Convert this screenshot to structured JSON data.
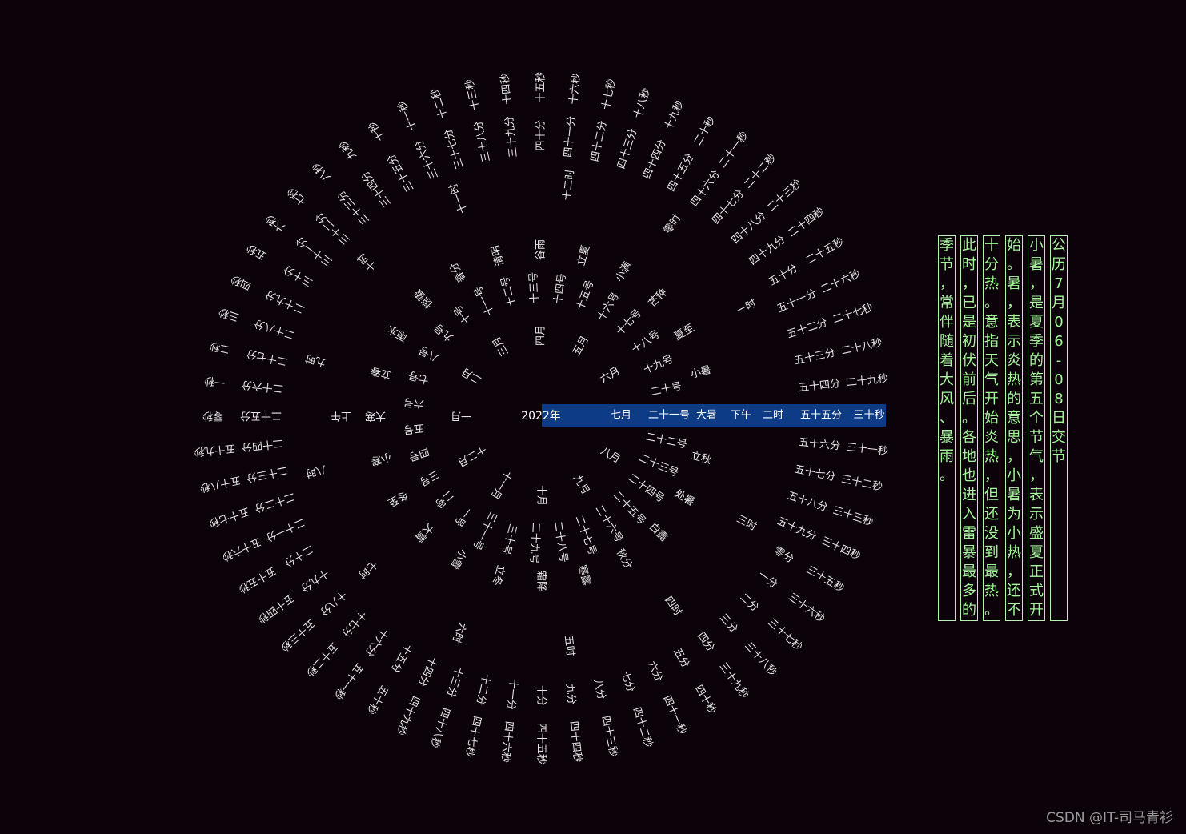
{
  "colors": {
    "background": "#0b0309",
    "highlight": "#0e3b86",
    "text": "#e6e6e6",
    "poem_text": "#a5f59a",
    "poem_border": "#b7f2b0"
  },
  "center": {
    "year": "2022年"
  },
  "rings": [
    {
      "name": "month",
      "current": 6,
      "labels": [
        "一月",
        "二月",
        "三月",
        "四月",
        "五月",
        "六月",
        "七月",
        "八月",
        "九月",
        "十月",
        "十一月",
        "十二月"
      ]
    },
    {
      "name": "solar-term",
      "current": 11,
      "labels": [
        "立春",
        "雨水",
        "惊蛰",
        "春分",
        "清明",
        "谷雨",
        "立夏",
        "小满",
        "芒种",
        "夏至",
        "小暑",
        "大暑",
        "立秋",
        "处暑",
        "白露",
        "秋分",
        "寒露",
        "霜降",
        "立冬",
        "小雪",
        "大雪",
        "冬至",
        "小寒",
        "大寒"
      ]
    },
    {
      "name": "day",
      "current": 20,
      "labels": [
        "一号",
        "二号",
        "三号",
        "四号",
        "五号",
        "六号",
        "七号",
        "八号",
        "九号",
        "十号",
        "十一号",
        "十二号",
        "十三号",
        "十四号",
        "十五号",
        "十六号",
        "十七号",
        "十八号",
        "十九号",
        "二十号",
        "二十一号",
        "二十二号",
        "二十三号",
        "二十四号",
        "二十五号",
        "二十六号",
        "二十七号",
        "二十八号",
        "二十九号",
        "三十号",
        "三十一号"
      ]
    },
    {
      "name": "ampm",
      "current": 1,
      "labels": [
        "上午",
        "下午"
      ]
    },
    {
      "name": "hour",
      "current": 2,
      "labels": [
        "零时",
        "一时",
        "二时",
        "三时",
        "四时",
        "五时",
        "六时",
        "七时",
        "八时",
        "九时",
        "十时",
        "十一时",
        "十二时"
      ]
    },
    {
      "name": "minute",
      "current": 55,
      "labels": [
        "零分",
        "一分",
        "二分",
        "三分",
        "四分",
        "五分",
        "六分",
        "七分",
        "八分",
        "九分",
        "十分",
        "十一分",
        "十二分",
        "十三分",
        "十四分",
        "十五分",
        "十六分",
        "十七分",
        "十八分",
        "十九分",
        "二十分",
        "二十一分",
        "二十二分",
        "二十三分",
        "二十四分",
        "二十五分",
        "二十六分",
        "二十七分",
        "二十八分",
        "二十九分",
        "三十分",
        "三十一分",
        "三十二分",
        "三十三分",
        "三十四分",
        "三十五分",
        "三十六分",
        "三十七分",
        "三十八分",
        "三十九分",
        "四十分",
        "四十一分",
        "四十二分",
        "四十三分",
        "四十四分",
        "四十五分",
        "四十六分",
        "四十七分",
        "四十八分",
        "四十九分",
        "五十分",
        "五十一分",
        "五十二分",
        "五十三分",
        "五十四分",
        "五十五分",
        "五十六分",
        "五十七分",
        "五十八分",
        "五十九分"
      ]
    },
    {
      "name": "second",
      "current": 30,
      "labels": [
        "零秒",
        "一秒",
        "二秒",
        "三秒",
        "四秒",
        "五秒",
        "六秒",
        "七秒",
        "八秒",
        "九秒",
        "十秒",
        "十一秒",
        "十二秒",
        "十三秒",
        "十四秒",
        "十五秒",
        "十六秒",
        "十七秒",
        "十八秒",
        "十九秒",
        "二十秒",
        "二十一秒",
        "二十二秒",
        "二十三秒",
        "二十四秒",
        "二十五秒",
        "二十六秒",
        "二十七秒",
        "二十八秒",
        "二十九秒",
        "三十秒",
        "三十一秒",
        "三十二秒",
        "三十三秒",
        "三十四秒",
        "三十五秒",
        "三十六秒",
        "三十七秒",
        "三十八秒",
        "三十九秒",
        "四十秒",
        "四十一秒",
        "四十二秒",
        "四十三秒",
        "四十四秒",
        "四十五秒",
        "四十六秒",
        "四十七秒",
        "四十八秒",
        "四十九秒",
        "五十秒",
        "五十一秒",
        "五十二秒",
        "五十三秒",
        "五十四秒",
        "五十五秒",
        "五十六秒",
        "五十七秒",
        "五十八秒",
        "五十九秒"
      ]
    }
  ],
  "poem": {
    "columns": [
      "公历7月06-08日交节",
      "小暑，是夏季的第五个节气，表示盛夏正式开",
      "始。暑，表示炎热的意思，小暑为小热，还不",
      "十分热。意指天气开始炎热，但还没到最热。",
      "此时，已是初伏前后。各地也进入雷暴最多的",
      "季节，常伴随着大风、暴雨。"
    ]
  },
  "watermark": "CSDN @IT-司马青衫"
}
